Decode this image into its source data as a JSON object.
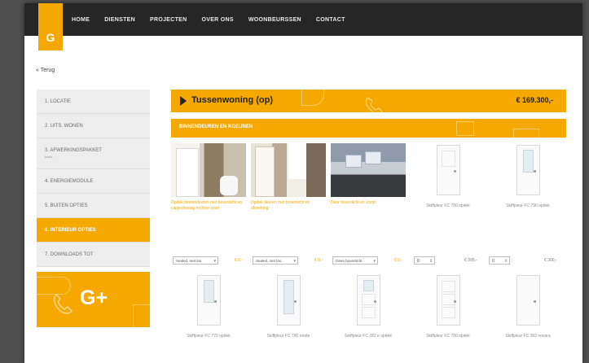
{
  "logo": {
    "text": "G"
  },
  "nav": [
    "HOME",
    "DIENSTEN",
    "PROJECTEN",
    "OVER ONS",
    "WOONBEURSSEN",
    "CONTACT"
  ],
  "back_link": "« Terug",
  "sidebar": {
    "items": [
      {
        "label": "1. LOCATIE"
      },
      {
        "label": "2. UITS. WONEN"
      },
      {
        "label": "3. AFWERKINGSPAKKET",
        "sub": "basis"
      },
      {
        "label": "4. ENERGIEMODULE"
      },
      {
        "label": "5. BUITEN OPTIES"
      },
      {
        "label": "6. INTERIEUR OPTIES",
        "active": true
      },
      {
        "label": "7. DOWNLOADS TOT"
      }
    ]
  },
  "promo": {
    "text": "G+"
  },
  "banner": {
    "title": "Tussenwoning (op)",
    "price": "€ 169.300,-"
  },
  "section": {
    "title": "BINNENDEUREN EN KOZIJNEN"
  },
  "row1": [
    {
      "caption": "Opdek binnendeuren met bovenlicht en capjesbeslag rechtse soort",
      "select": "Sealed, met las.",
      "price": "€ 0,-"
    },
    {
      "caption": "Opdek deuren met bovenlicht en afwerking",
      "select": "Sealed, met las.",
      "price": "€ 0,-"
    },
    {
      "caption": "Deur bovenlicht en kozijn",
      "select": "Geen bovenlicht",
      "price": "€ 0,-"
    },
    {
      "caption": "Skiffpleur FC 780 opdek",
      "qty": "0",
      "price": "€ 395,-"
    },
    {
      "caption": "Skiffpleur FC 790 opdek",
      "qty": "0",
      "price": "€ 300,-"
    }
  ],
  "row2": [
    {
      "caption": "Skiffpleur FC 770 opdek"
    },
    {
      "caption": "Skiffpleur FC 790 ronde"
    },
    {
      "caption": "Skiffpleur FC 282 e opdek"
    },
    {
      "caption": "Skiffpleur FC 780 opdek"
    },
    {
      "caption": "Skiffpleur FC 393 novara"
    }
  ],
  "colors": {
    "accent": "#f4a800",
    "topbar": "#262626",
    "sidebar": "#ededed"
  }
}
